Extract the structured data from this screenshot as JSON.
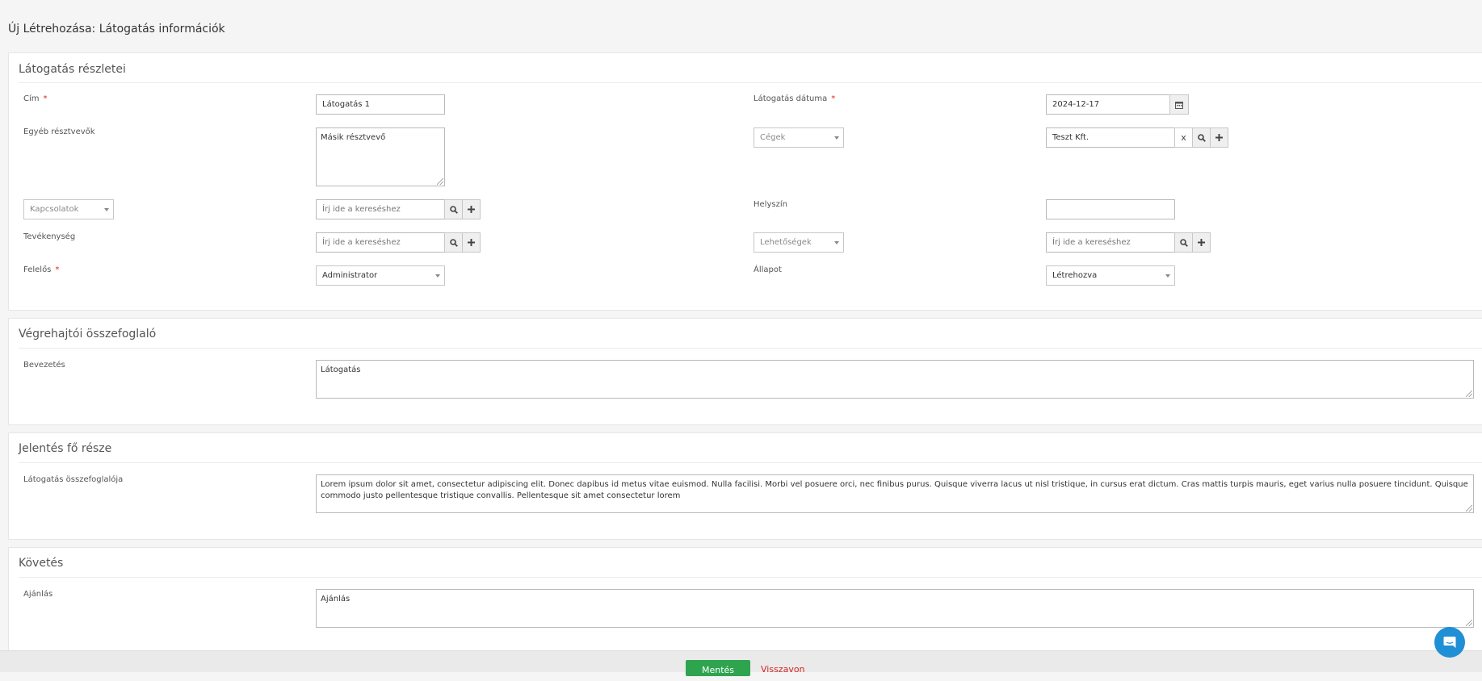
{
  "page": {
    "title": "Új Létrehozása: Látogatás információk"
  },
  "sections": {
    "details": {
      "title": "Látogatás részletei",
      "cim_label": "Cím",
      "cim_value": "Látogatás 1",
      "date_label": "Látogatás dátuma",
      "date_value": "2024-12-17",
      "others_label": "Egyéb résztvevők",
      "others_value": "Másik résztvevő",
      "companies_select": "Cégek",
      "company_value": "Teszt Kft.",
      "clear_x": "x",
      "contacts_select": "Kapcsolatok",
      "search_placeholder": "Írj ide a kereséshez",
      "location_label": "Helyszín",
      "location_value": "",
      "activity_label": "Tevékenység",
      "opportunities_select": "Lehetőségek",
      "responsible_label": "Felelős",
      "responsible_value": "Administrator",
      "status_label": "Állapot",
      "status_value": "Létrehozva"
    },
    "exec": {
      "title": "Végrehajtói összefoglaló",
      "intro_label": "Bevezetés",
      "intro_value": "Látogatás"
    },
    "main": {
      "title": "Jelentés fő része",
      "summary_label": "Látogatás összefoglalója",
      "summary_value": "Lorem ipsum dolor sit amet, consectetur adipiscing elit. Donec dapibus id metus vitae euismod. Nulla facilisi. Morbi vel posuere orci, nec finibus purus. Quisque viverra lacus ut nisl tristique, in cursus erat dictum. Cras mattis turpis mauris, eget varius nulla posuere tincidunt. Quisque commodo justo pellentesque tristique convallis. Pellentesque sit amet consectetur lorem"
    },
    "followup": {
      "title": "Követés",
      "recommend_label": "Ajánlás",
      "recommend_value": "Ajánlás"
    }
  },
  "footer": {
    "save": "Mentés",
    "cancel": "Visszavon"
  },
  "icons": {
    "required_mark": "*",
    "search": "search-icon",
    "plus": "plus-icon",
    "calendar": "calendar-icon",
    "chat": "chat-icon"
  },
  "colors": {
    "required": "#e02424",
    "save": "#2ea44f",
    "cancel": "#d32424",
    "chat": "#1f8fd6"
  }
}
